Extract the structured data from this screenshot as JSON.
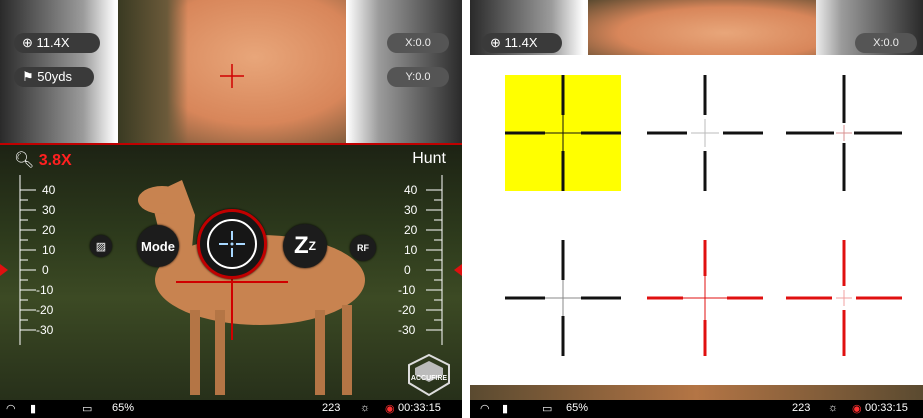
{
  "left": {
    "zoom_label": "11.4X",
    "distance_label": "50yds",
    "x_label": "X:0.0",
    "y_label": "Y:0.0",
    "magnification": "3.8X",
    "mode_name": "Hunt",
    "scale_values": [
      "40",
      "30",
      "20",
      "10",
      "0",
      "-10",
      "-20",
      "-30"
    ],
    "buttons": {
      "picture_icon": "image-icon",
      "mode_label": "Mode",
      "crosshair_icon": "crosshair-icon",
      "sleep_label": "Z",
      "sleep_sup": "Z",
      "rf_label": "RF"
    },
    "logo_text": "ACCUFIRE",
    "status": {
      "battery": "65%",
      "count": "223",
      "time": "00:33:15"
    }
  },
  "right": {
    "zoom_label": "11.4X",
    "x_label": "X:0.0",
    "status": {
      "battery": "65%",
      "count": "223",
      "time": "00:33:15"
    },
    "reticles": [
      {
        "id": "reticle-1",
        "style": "black-thick-with-thin-center",
        "selected": true
      },
      {
        "id": "reticle-2",
        "style": "black-thick-gap-gray-center",
        "selected": false
      },
      {
        "id": "reticle-3",
        "style": "black-thick-gap-pink-center",
        "selected": false
      },
      {
        "id": "reticle-4",
        "style": "black-thick-gray-thin-center",
        "selected": false
      },
      {
        "id": "reticle-5",
        "style": "red-thick-thin-center",
        "selected": false
      },
      {
        "id": "reticle-6",
        "style": "red-thick-gap-center",
        "selected": false
      }
    ]
  },
  "colors": {
    "accent_red": "#d00000",
    "selected_yellow": "#ffff00",
    "crosshair_blue": "#a8d8ff"
  }
}
